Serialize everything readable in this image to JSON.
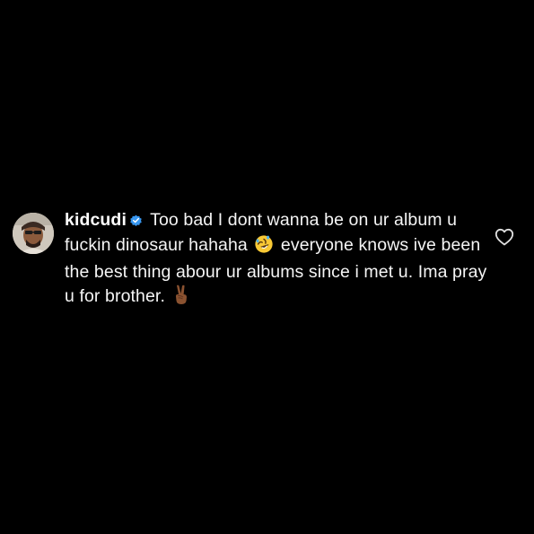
{
  "comment": {
    "username": "kidcudi",
    "text_before_emoji": "Too bad I dont wanna be on ur album u fuckin dinosaur hahaha",
    "emoji_1": "rolling-on-floor-laughing",
    "text_middle": "everyone knows ive been the best thing abour ur albums since i met u.  Ima pray u for brother.",
    "emoji_2": "victory-hand"
  },
  "colors": {
    "background": "#000000",
    "text": "#f5f5f5",
    "verified_badge": "#3897f0",
    "heart_outline": "#e0e0e0"
  },
  "icons": {
    "verified": "verified-badge-icon",
    "like": "heart-outline-icon"
  }
}
